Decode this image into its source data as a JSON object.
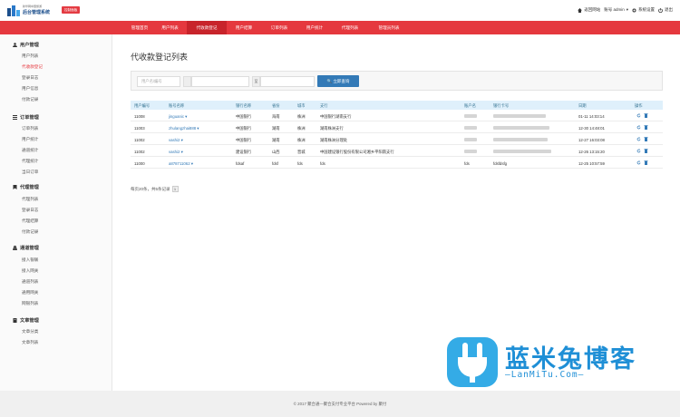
{
  "header": {
    "brand_small": "新华网中国旅游",
    "brand": "后台管理系统",
    "badge": "控制面板",
    "links": [
      "返回网站",
      "账号 admin",
      "系统设置",
      "退出"
    ]
  },
  "nav": {
    "items": [
      "管理首页",
      "用户列表",
      "代收款登记",
      "用户结算",
      "订单列表",
      "用户统计",
      "代理列表",
      "管理员列表"
    ],
    "active_index": 2
  },
  "sidebar": {
    "groups": [
      {
        "title": "用户管理",
        "icon": "user-icon",
        "items": [
          "用户列表",
          "代收款登记",
          "登录日志",
          "用户信息",
          "付款记录"
        ]
      },
      {
        "title": "订单管理",
        "icon": "list-icon",
        "items": [
          "订单列表",
          "用户统计",
          "通道统计",
          "代理统计",
          "当日订单"
        ]
      },
      {
        "title": "代理管理",
        "icon": "bookmark-icon",
        "items": [
          "代理列表",
          "登录日志",
          "代理结算",
          "付款记录"
        ]
      },
      {
        "title": "通道管理",
        "icon": "road-icon",
        "items": [
          "接入银联",
          "接入网关",
          "通道列表",
          "通用网关",
          "网银列表"
        ]
      },
      {
        "title": "文章管理",
        "icon": "book-icon",
        "items": [
          "文章分类",
          "文章列表"
        ]
      }
    ],
    "active_item": "代收款登记"
  },
  "main": {
    "title": "代收款登记列表",
    "search": {
      "user_placeholder": "用户名/编号",
      "addon1": "",
      "addon2": "至",
      "button": "立即查询"
    },
    "table": {
      "headers": [
        "用户编号",
        "账号名称",
        "银行名称",
        "省份",
        "城市",
        "支行",
        "账户名",
        "银行卡号",
        "日期",
        "操作"
      ],
      "rows": [
        {
          "id": "11008",
          "account": "jinguanic",
          "bank": "中国银行",
          "province": "海南",
          "city": "株洲",
          "branch": "中国银行湖南支行",
          "holder": "",
          "card": "",
          "date": "01-11 14:03:14"
        },
        {
          "id": "11003",
          "account": "zhulangzhai888",
          "bank": "中国银行",
          "province": "湖南",
          "city": "株洲",
          "branch": "湖南株洲支行",
          "holder": "",
          "card": "",
          "date": "12-30 14:48:01"
        },
        {
          "id": "11002",
          "account": "vashi2",
          "bank": "中国银行",
          "province": "湖南",
          "city": "株洲",
          "branch": "湖南株洲分理处",
          "holder": "",
          "card": "",
          "date": "12-27 16:03:08"
        },
        {
          "id": "11002",
          "account": "vashi2",
          "bank": "建设银行",
          "province": "山西",
          "city": "晋城",
          "branch": "中国建设银行股份有限公司湘乡平阳南支行",
          "holder": "",
          "card": "",
          "date": "12-26 13:15:20"
        },
        {
          "id": "11000",
          "account": "a878711062",
          "bank": "fdsaf",
          "province": "fdsf",
          "city": "fds",
          "branch": "fds",
          "holder": "fds",
          "card": "fdsfdsfg",
          "date": "12-25 10:57:59"
        }
      ]
    },
    "pager": {
      "text": "每页20条，共5条记录",
      "page": "1"
    }
  },
  "footer": {
    "text": "© 2017 聚合通—聚合支付专业平台 Powered by 聚付"
  },
  "watermark": {
    "text": "蓝米兔博客",
    "sub": "—LanMiTu.Com—"
  },
  "colors": {
    "primary": "#e5383e",
    "active_nav": "#c8242b",
    "link": "#337ab7",
    "button": "#337ab7",
    "table_head": "#dff0fb"
  }
}
